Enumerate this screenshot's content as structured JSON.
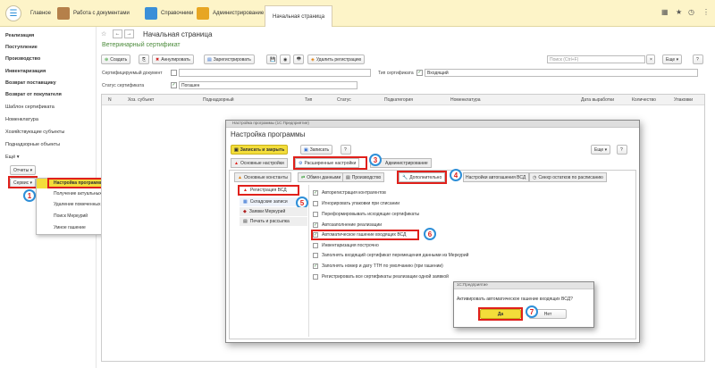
{
  "topbar": {
    "tabs": [
      "Главное",
      "Работа с документами",
      "Справочники",
      "Администрирование",
      "Начальная страница"
    ]
  },
  "sidebar": {
    "items": [
      "Реализация",
      "Поступление",
      "Производство",
      "Инвентаризация",
      "Возврат поставщику",
      "Возврат от покупателя",
      "Шаблон сертификата",
      "Номенклатура",
      "Хозяйствующие субъекты",
      "Поднадзорные объекты",
      "Ещё ▾"
    ],
    "reports": "Отчеты ▾",
    "service": "Сервис ▾"
  },
  "service_menu": {
    "items": [
      "Настройка программы",
      "Получение актуальных складских записей",
      "Удаление помеченных объектов",
      "Поиск Меркурий",
      "Умное гашение"
    ]
  },
  "main": {
    "page_title": "Начальная страница",
    "section_title": "Ветеринарный сертификат",
    "toolbar": {
      "create": "Создать",
      "annul": "Аннулировать",
      "register": "Зарегистрировать",
      "delete_reg": "Удалить регистрацию",
      "more": "Еще ▾",
      "help": "?"
    },
    "search_placeholder": "Поиск (Ctrl+F)",
    "filters": {
      "cert_doc": "Сертифицируемый документ",
      "cert_type": "Тип сертификата",
      "cert_type_value": "Входящий",
      "cert_status": "Статус сертификата",
      "cert_status_value": "Погашен"
    },
    "columns": [
      "N",
      "Хоз. субъект",
      "Поднадзорный",
      "Тип",
      "Статус",
      "Подкатегория",
      "Номенклатура",
      "Дата выработки",
      "Количество",
      "Упаковки"
    ]
  },
  "dialog": {
    "window_title": "Настройка программы (1С:Предприятие)",
    "title": "Настройка программы",
    "save_close": "Записать и закрыть",
    "save": "Записать",
    "help": "?",
    "more": "Еще ▾",
    "tabs_top": [
      "Основные настройки",
      "Расширенные настройки",
      "Администрирование"
    ],
    "tabs_inner": [
      "Основные константы",
      "Обмен данными",
      "Производство",
      "Дополнительно",
      "Настройки автогашения ВСД",
      "Синхр остатков по расписанию"
    ],
    "sections": [
      "Регистрация ВСД",
      "Складские записи",
      "Заявки Меркурий",
      "Печать и рассылка"
    ],
    "checkboxes": [
      {
        "label": "Авторегистрация контрагентов",
        "checked": true
      },
      {
        "label": "Игнорировать упаковки при списании",
        "checked": false
      },
      {
        "label": "Переформировывать исходящие сертификаты",
        "checked": false
      },
      {
        "label": "Автозаполнение реализации",
        "checked": true
      },
      {
        "label": "Автоматическое гашение входящих ВСД",
        "checked": true
      },
      {
        "label": "Инвентаризация построчно",
        "checked": false
      },
      {
        "label": "Заполнять входящий сертификат перемещения данными из Меркурий",
        "checked": false
      },
      {
        "label": "Заполнять номер и дату ТТН по умолчанию (при гашении)",
        "checked": true
      },
      {
        "label": "Регистрировать все сертификаты реализации одной заявкой",
        "checked": false
      }
    ]
  },
  "confirm": {
    "title": "1С:Предприятие",
    "message": "Активировать автоматическое гашение входящих ВСД?",
    "yes": "Да",
    "no": "Нет"
  },
  "steps": [
    "1",
    "2",
    "3",
    "4",
    "5",
    "6",
    "7"
  ]
}
